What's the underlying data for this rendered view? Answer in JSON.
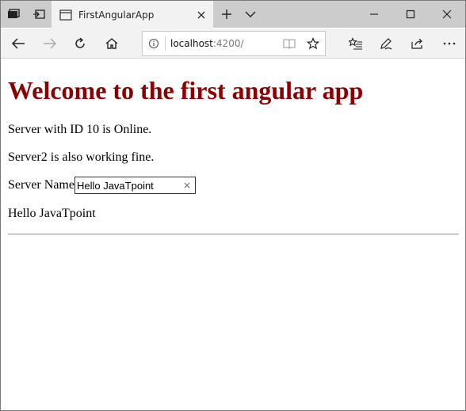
{
  "browser": {
    "tab": {
      "title": "FirstAngularApp"
    },
    "address": {
      "host": "localhost",
      "rest": ":4200/"
    }
  },
  "page": {
    "heading": "Welcome to the first angular app",
    "server_status": "Server with ID 10 is Online.",
    "server2_status": "Server2 is also working fine.",
    "server_name_label": "Server Name",
    "server_name_value": "Hello JavaTpoint",
    "clear_glyph": "×",
    "echo_text": "Hello JavaTpoint"
  },
  "colors": {
    "heading": "#8b0000",
    "tabstrip": "#cccccc",
    "navbar": "#f2f2f2"
  },
  "icons": [
    "tab-actions-icon",
    "set-aside-icon",
    "page-icon",
    "close-icon",
    "new-tab-icon",
    "chevron-down-icon",
    "minimize-icon",
    "maximize-icon",
    "window-close-icon",
    "back-icon",
    "forward-icon",
    "refresh-icon",
    "home-icon",
    "info-icon",
    "reading-view-icon",
    "favorite-star-icon",
    "favorites-hub-icon",
    "notes-pen-icon",
    "share-icon",
    "more-icon"
  ]
}
